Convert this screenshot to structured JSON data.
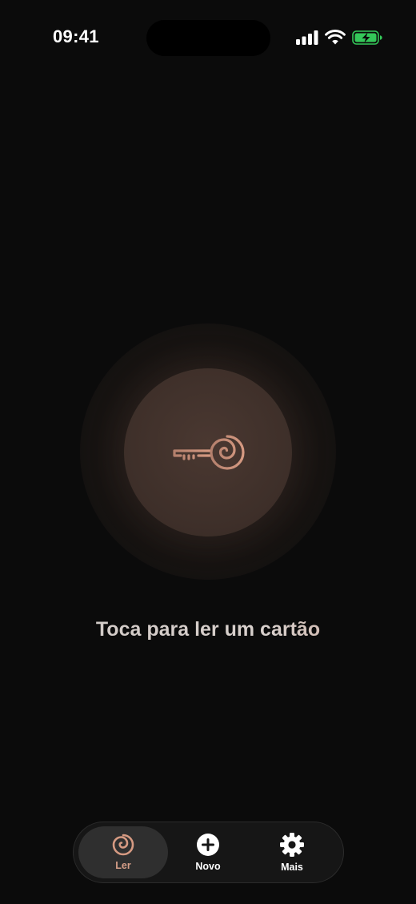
{
  "status_bar": {
    "time": "09:41",
    "icons": [
      "cellular-signal-icon",
      "wifi-icon",
      "battery-charging-icon"
    ],
    "battery_color": "#34c759"
  },
  "reader": {
    "icon": "key-spiral-icon",
    "prompt": "Toca para ler um cartão",
    "accent_color": "#c98a73"
  },
  "tab_bar": {
    "selected": "ler",
    "items": [
      {
        "id": "ler",
        "label": "Ler",
        "icon": "spiral-icon"
      },
      {
        "id": "novo",
        "label": "Novo",
        "icon": "plus-circle-icon"
      },
      {
        "id": "mais",
        "label": "Mais",
        "icon": "gear-icon"
      }
    ]
  }
}
